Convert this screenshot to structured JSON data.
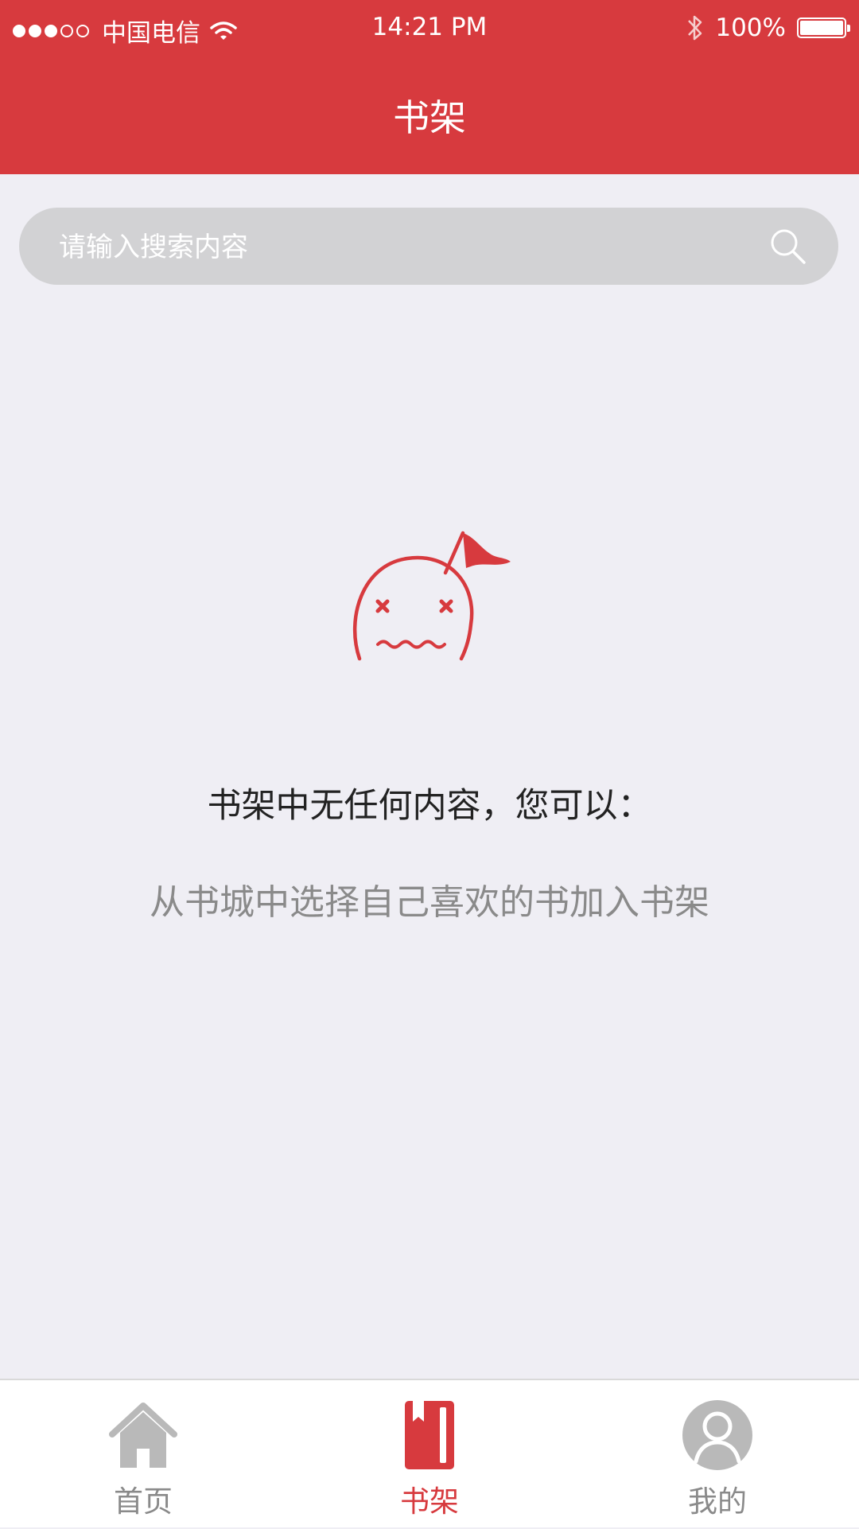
{
  "status_bar": {
    "carrier": "中国电信",
    "time": "14:21 PM",
    "battery_text": "100%",
    "battery_level": 1.0,
    "signal_strength": 3,
    "signal_max": 5
  },
  "header": {
    "title": "书架"
  },
  "search": {
    "placeholder": "请输入搜索内容",
    "icon": "search-icon"
  },
  "empty_state": {
    "icon": "confused-face-flag-icon",
    "title": "书架中无任何内容，您可以：",
    "hint": "从书城中选择自己喜欢的书加入书架"
  },
  "tabbar": {
    "items": [
      {
        "label": "首页",
        "icon": "home-icon",
        "active": false
      },
      {
        "label": "书架",
        "icon": "bookshelf-icon",
        "active": true
      },
      {
        "label": "我的",
        "icon": "user-icon",
        "active": false
      }
    ]
  },
  "colors": {
    "brand": "#d73a3e",
    "background": "#efeef4",
    "search_bg": "#d2d2d4",
    "inactive": "#8a8a8a"
  }
}
